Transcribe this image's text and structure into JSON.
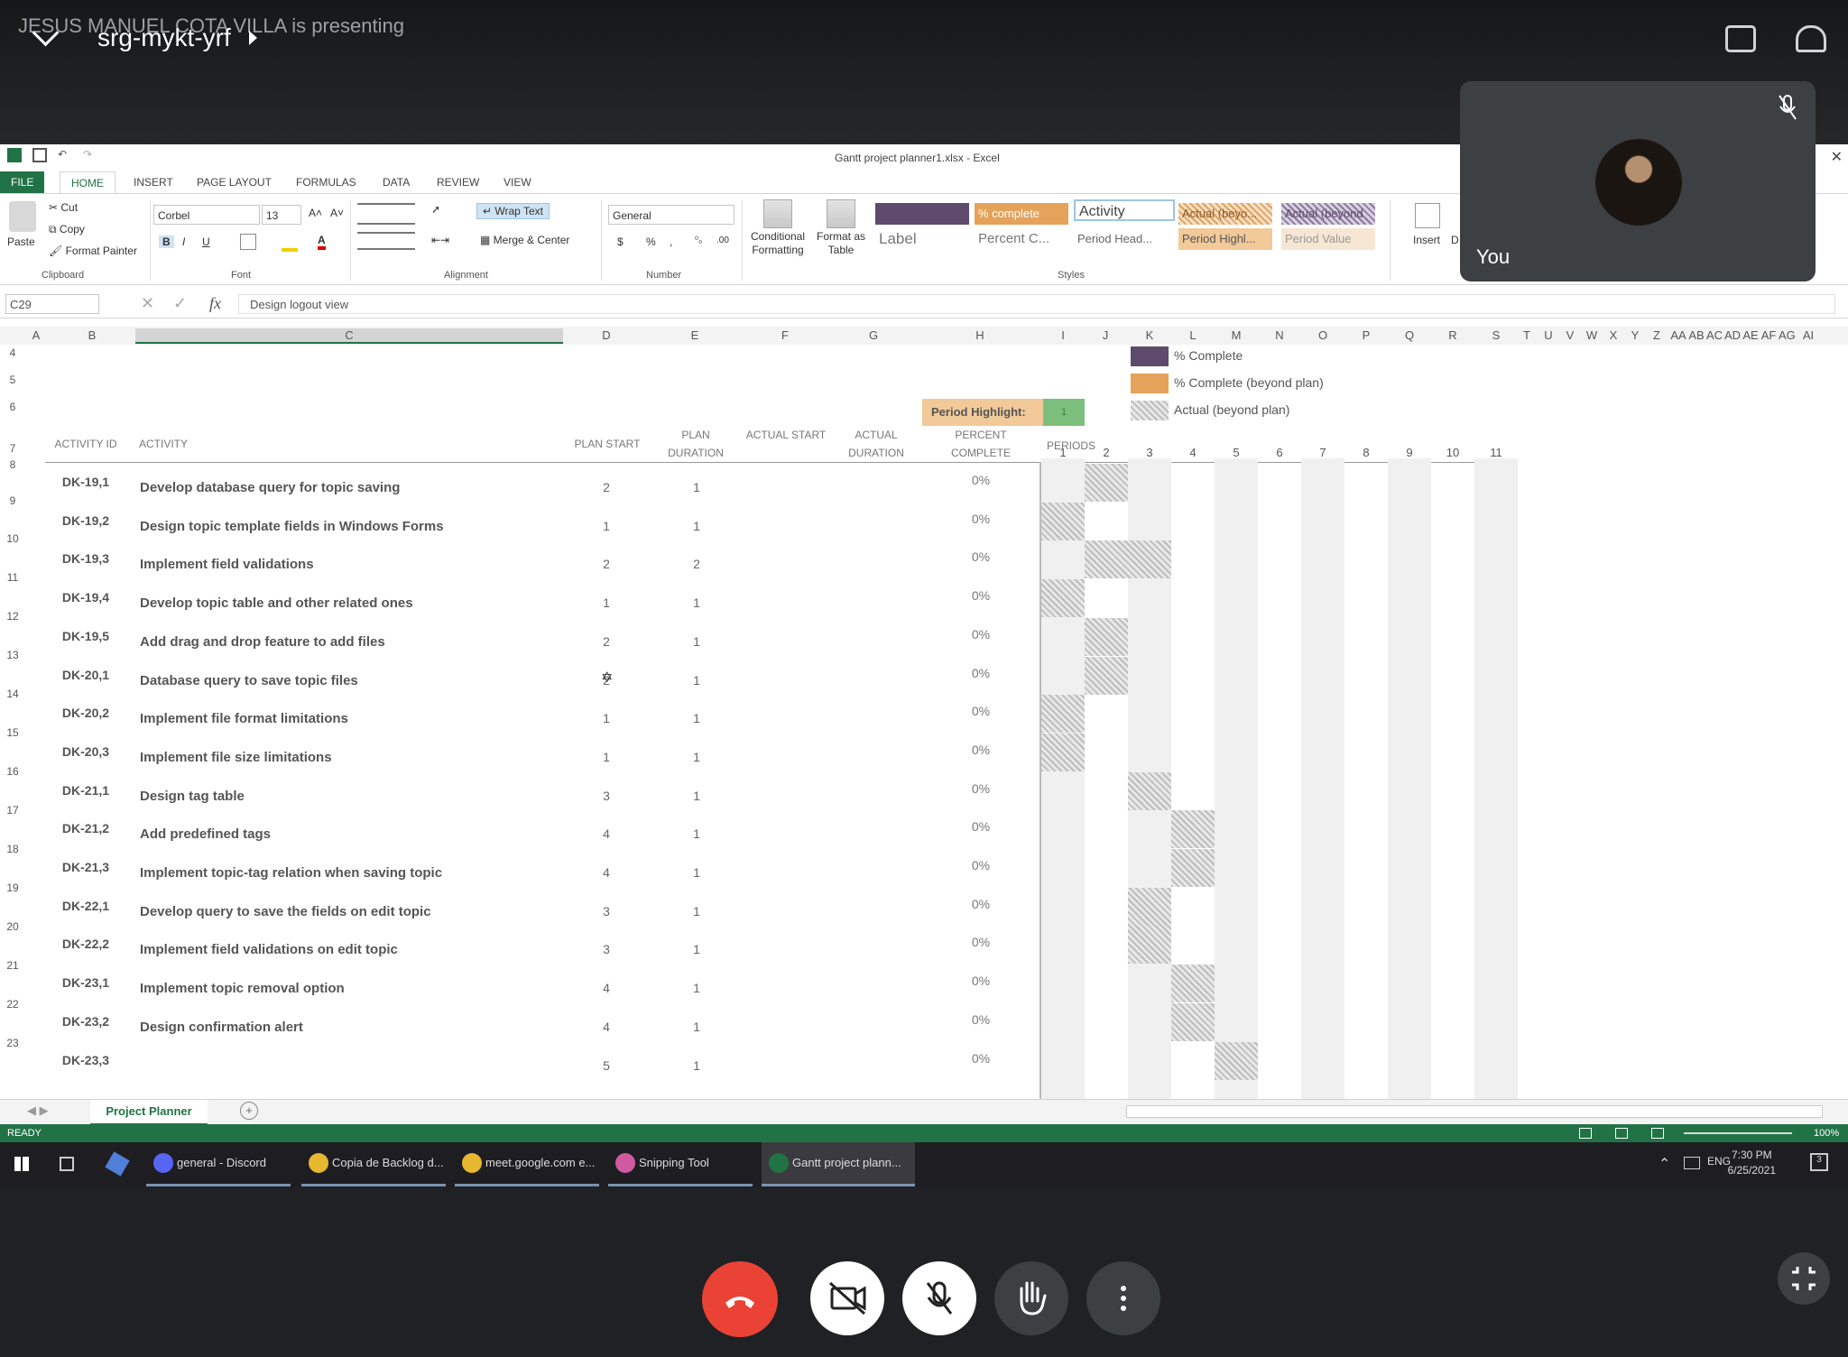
{
  "meet": {
    "presenter": "JESUS MANUEL COTA VILLA is presenting",
    "meeting_code": "srg-mykt-yrf",
    "self_label": "You"
  },
  "excel": {
    "title": "Gantt project planner1.xlsx - Excel",
    "tabs": [
      "FILE",
      "HOME",
      "INSERT",
      "PAGE LAYOUT",
      "FORMULAS",
      "DATA",
      "REVIEW",
      "VIEW"
    ],
    "ribbon": {
      "clipboard": {
        "paste": "Paste",
        "cut": "Cut",
        "copy": "Copy",
        "format_painter": "Format Painter",
        "group": "Clipboard"
      },
      "font": {
        "name": "Corbel",
        "size": "13",
        "bold": "B",
        "italic": "I",
        "underline": "U",
        "grow": "A˄",
        "shrink": "A˅",
        "color": "A",
        "group": "Font"
      },
      "alignment": {
        "wrap": "Wrap Text",
        "merge": "Merge & Center",
        "group": "Alignment"
      },
      "number": {
        "format": "General",
        "currency": "$",
        "percent": "%",
        "comma": ",",
        "inc": "⁰₀",
        "dec": ".00",
        "group": "Number"
      },
      "cf": {
        "conditional": "Conditional Formatting",
        "format_table": "Format as Table"
      },
      "styles": {
        "row1": [
          "",
          "% complete",
          "Activity",
          "Actual (beyo...",
          "Actual (beyond"
        ],
        "row2": [
          "Label",
          "Percent C...",
          "Period Head...",
          "Period Highl...",
          "Period Value"
        ],
        "group": "Styles"
      },
      "cells": {
        "insert": "Insert",
        "delete": "D"
      }
    },
    "formula_bar": {
      "name_box": "C29",
      "fx": "fx",
      "value": "Design logout view"
    },
    "columns": [
      "A",
      "B",
      "C",
      "D",
      "E",
      "F",
      "G",
      "H",
      "I",
      "J",
      "K",
      "L",
      "M",
      "N",
      "O",
      "P",
      "Q",
      "R",
      "S",
      "T",
      "U",
      "V",
      "W",
      "X",
      "Y",
      "Z",
      "AA",
      "AB",
      "AC",
      "AD",
      "AE",
      "AF",
      "AG",
      "AI"
    ],
    "legend": [
      {
        "label": "% Complete",
        "color": "#5e4a6b"
      },
      {
        "label": "% Complete (beyond plan)",
        "color": "#e4a25a"
      },
      {
        "label": "Actual (beyond plan)",
        "color": "#b9b9b9"
      }
    ],
    "period_highlight": {
      "label": "Period Highlight:",
      "value": "1"
    },
    "headers": {
      "activity_id": "ACTIVITY ID",
      "activity": "ACTIVITY",
      "plan_start": "PLAN START",
      "plan_duration": "PLAN DURATION",
      "actual_start": "ACTUAL START",
      "actual_duration": "ACTUAL DURATION",
      "percent_complete": "PERCENT COMPLETE",
      "periods": "PERIODS"
    },
    "periods": [
      "1",
      "2",
      "3",
      "4",
      "5",
      "6",
      "7",
      "8",
      "9",
      "10",
      "11"
    ],
    "row_numbers": [
      "4",
      "5",
      "6",
      "7",
      "8",
      "9",
      "10",
      "11",
      "12",
      "13",
      "14",
      "15",
      "16",
      "17",
      "18",
      "19",
      "20",
      "21",
      "22",
      "23"
    ],
    "rows": [
      {
        "id": "DK-19,1",
        "activity": "Develop database query for topic saving",
        "start": "2",
        "duration": "1",
        "pct": "0%"
      },
      {
        "id": "DK-19,2",
        "activity": "Design topic template fields in Windows Forms",
        "start": "1",
        "duration": "1",
        "pct": "0%"
      },
      {
        "id": "DK-19,3",
        "activity": "Implement field validations",
        "start": "2",
        "duration": "2",
        "pct": "0%"
      },
      {
        "id": "DK-19,4",
        "activity": "Develop topic table and other related ones",
        "start": "1",
        "duration": "1",
        "pct": "0%"
      },
      {
        "id": "DK-19,5",
        "activity": "Add drag and drop feature to add files",
        "start": "2",
        "duration": "1",
        "pct": "0%"
      },
      {
        "id": "DK-20,1",
        "activity": "Database query to save topic files",
        "start": "2",
        "duration": "1",
        "pct": "0%"
      },
      {
        "id": "DK-20,2",
        "activity": "Implement file format limitations",
        "start": "1",
        "duration": "1",
        "pct": "0%"
      },
      {
        "id": "DK-20,3",
        "activity": "Implement file size limitations",
        "start": "1",
        "duration": "1",
        "pct": "0%"
      },
      {
        "id": "DK-21,1",
        "activity": "Design tag table",
        "start": "3",
        "duration": "1",
        "pct": "0%"
      },
      {
        "id": "DK-21,2",
        "activity": "Add predefined tags",
        "start": "4",
        "duration": "1",
        "pct": "0%"
      },
      {
        "id": "DK-21,3",
        "activity": "Implement topic-tag relation when saving topic",
        "start": "4",
        "duration": "1",
        "pct": "0%"
      },
      {
        "id": "DK-22,1",
        "activity": "Develop query to save the fields on edit topic",
        "start": "3",
        "duration": "1",
        "pct": "0%"
      },
      {
        "id": "DK-22,2",
        "activity": "Implement field validations on edit topic",
        "start": "3",
        "duration": "1",
        "pct": "0%"
      },
      {
        "id": "DK-23,1",
        "activity": "Implement topic removal option",
        "start": "4",
        "duration": "1",
        "pct": "0%"
      },
      {
        "id": "DK-23,2",
        "activity": "Design confirmation alert",
        "start": "4",
        "duration": "1",
        "pct": "0%"
      },
      {
        "id": "DK-23,3",
        "activity": "",
        "start": "5",
        "duration": "1",
        "pct": "0%"
      }
    ],
    "sheet_tab": "Project Planner",
    "status": "READY",
    "zoom": "100%"
  },
  "taskbar": {
    "items": [
      {
        "label": "general - Discord",
        "color": "#5865f2"
      },
      {
        "label": "Copia de Backlog d...",
        "color": "#e8b730"
      },
      {
        "label": "meet.google.com e...",
        "color": "#e8b730"
      },
      {
        "label": "Snipping Tool",
        "color": "#d05aa0"
      },
      {
        "label": "Gantt project plann...",
        "color": "#217346"
      }
    ],
    "lang": "ENG",
    "time": "7:30 PM",
    "date": "6/25/2021",
    "notif": "3"
  },
  "colors": {
    "excel_green": "#217346",
    "end_call": "#ea4335"
  }
}
